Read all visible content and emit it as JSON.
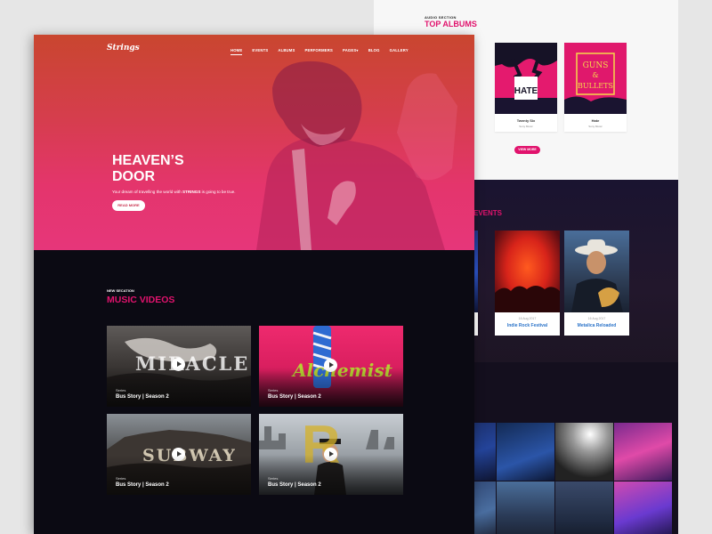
{
  "colors": {
    "accent": "#e1136d",
    "link": "#2c74c9",
    "dark": "#0b0a13"
  },
  "nav": {
    "logo": "Strings",
    "items": [
      "HOME",
      "EVENTS",
      "ALBUMS",
      "PERFORMERS",
      "PAGES",
      "BLOG",
      "GALLERY"
    ],
    "pages_chevron": "▾"
  },
  "hero": {
    "title_line1": "HEAVEN’S",
    "title_line2": "DOOR",
    "text_before": "Your dream of travelling the world with ",
    "text_brand": "STRINGS",
    "text_after": " is going to be true.",
    "cta": "READ MORE"
  },
  "videos": {
    "kicker": "NEW SECATION",
    "title": "MUSIC VIDEOS",
    "cards": [
      {
        "word": "MIRACLE",
        "series": "Series",
        "name": "Bus Story | Season 2"
      },
      {
        "word": "Alchemist",
        "series": "Series",
        "name": "Bus Story | Season 2"
      },
      {
        "word": "SUBWAY",
        "series": "Series",
        "name": "Bus Story | Season 2"
      },
      {
        "word": "R",
        "series": "Series",
        "name": "Bus Story | Season 2"
      }
    ]
  },
  "albums": {
    "kicker": "AUDIO SECTION",
    "title": "TOP ALBUMS",
    "items": [
      {
        "name": "",
        "artist": ""
      },
      {
        "name": "Twenty Six",
        "artist": "Sony Music",
        "cover_text": "HATE"
      },
      {
        "name": "Hate",
        "artist": "Sony Music",
        "cover_text_1": "GUNS",
        "cover_text_2": "&",
        "cover_text_3": "BULLETS"
      }
    ],
    "cta": "VIEW MORE"
  },
  "events": {
    "title": "EVENTS",
    "items": [
      {
        "date": "",
        "name": ""
      },
      {
        "date": "16 Aug 2017",
        "name": "Indie Rock Festival"
      },
      {
        "date": "16 Aug 2017",
        "name": "Metalica Reloaded"
      }
    ]
  }
}
